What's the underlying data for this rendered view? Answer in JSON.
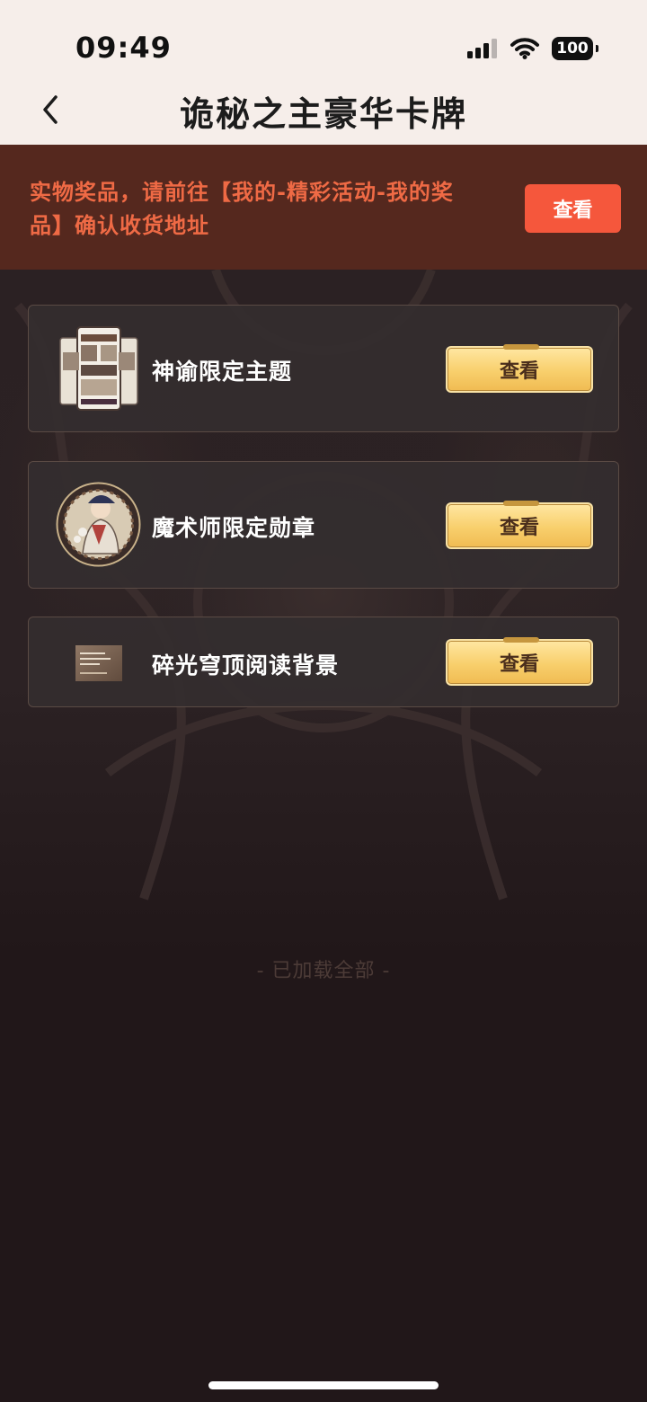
{
  "status_bar": {
    "time": "09:49",
    "battery": "100"
  },
  "nav": {
    "back_icon": "chevron-left-icon",
    "title": "诡秘之主豪华卡牌"
  },
  "notice": {
    "text": "实物奖品，请前往【我的-精彩活动-我的奖品】确认收货地址",
    "button_label": "查看",
    "text_color": "#ef6a45",
    "button_color": "#f5573c"
  },
  "rewards": [
    {
      "name": "神谕限定主题",
      "button_label": "查看",
      "thumb_icon": "theme-preview-icon"
    },
    {
      "name": "魔术师限定勋章",
      "button_label": "查看",
      "thumb_icon": "magician-badge-icon"
    },
    {
      "name": "碎光穹顶阅读背景",
      "button_label": "查看",
      "thumb_icon": "reading-background-icon"
    }
  ],
  "footer": {
    "loaded_all": "- 已加载全部 -"
  },
  "colors": {
    "header_bg": "#f6eeea",
    "notice_bg": "#55281e",
    "page_bg": "#211719",
    "gold_button": "#f8cf6c"
  }
}
